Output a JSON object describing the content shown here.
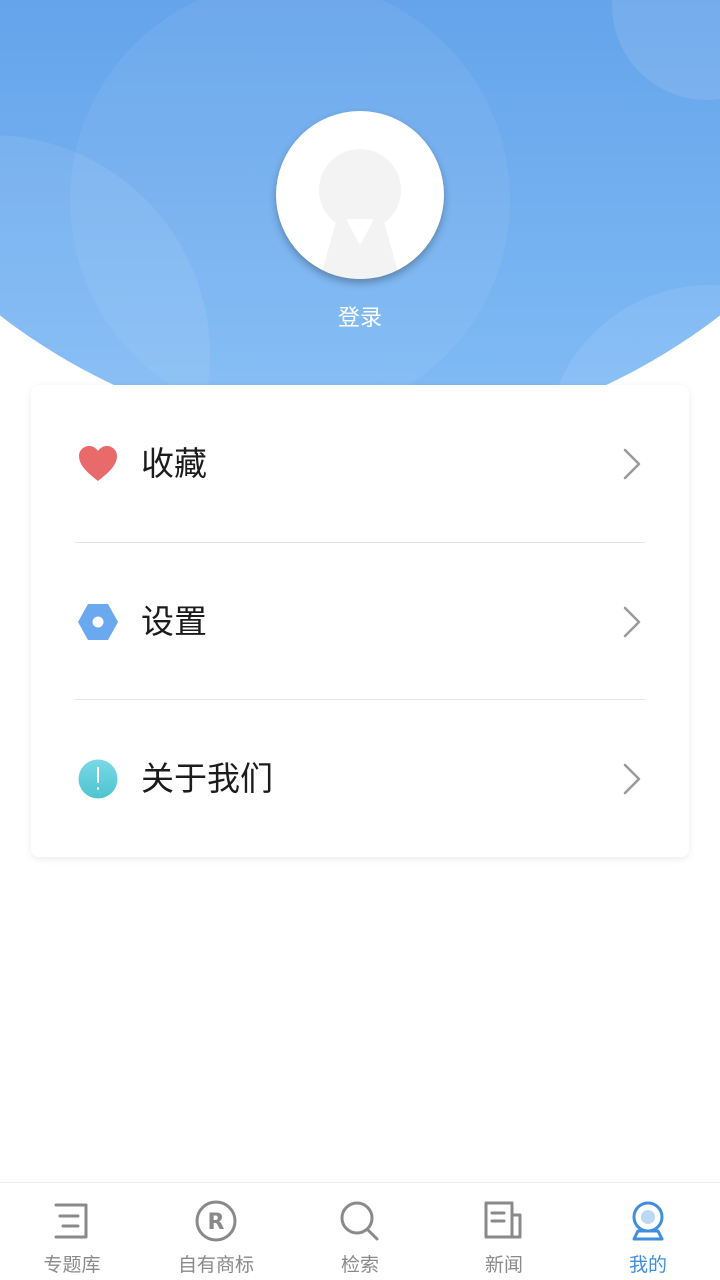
{
  "profile": {
    "login_label": "登录"
  },
  "menu": [
    {
      "label": "收藏",
      "icon": "heart-icon"
    },
    {
      "label": "设置",
      "icon": "settings-hexagon-icon"
    },
    {
      "label": "关于我们",
      "icon": "info-icon"
    }
  ],
  "nav": [
    {
      "label": "专题库",
      "icon": "topic-list-icon"
    },
    {
      "label": "自有商标",
      "icon": "registered-trademark-icon"
    },
    {
      "label": "检索",
      "icon": "search-icon"
    },
    {
      "label": "新闻",
      "icon": "news-icon"
    },
    {
      "label": "我的",
      "icon": "profile-icon",
      "active": true
    }
  ],
  "colors": {
    "header_blue": "#5a9be6",
    "active_nav": "#3f8fdc",
    "heart": "#e86a6a",
    "settings": "#6aa8ef",
    "info": "#5ccfd8"
  }
}
